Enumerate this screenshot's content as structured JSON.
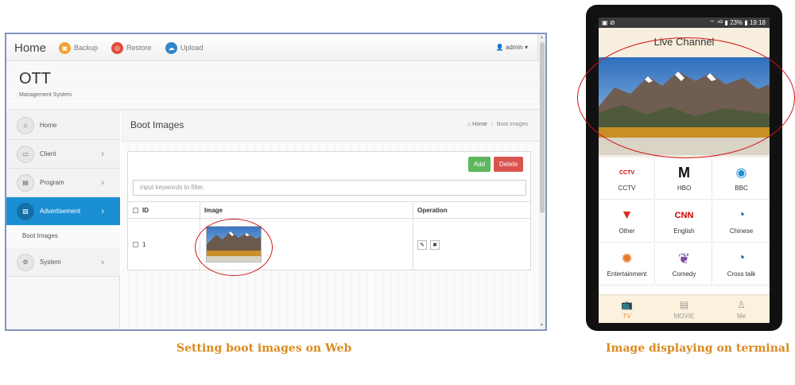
{
  "web": {
    "brand": "Home",
    "top_buttons": [
      {
        "label": "Backup",
        "icon": "backup-icon",
        "color": "#efa130",
        "glyph": "▣"
      },
      {
        "label": "Restore",
        "icon": "restore-icon",
        "color": "#e14b3b",
        "glyph": "◎"
      },
      {
        "label": "Upload",
        "icon": "cloud-upload-icon",
        "color": "#2f87c8",
        "glyph": "☁"
      }
    ],
    "user": {
      "name": "admin",
      "caret": "▾",
      "glyph": "👤"
    },
    "header": {
      "title": "OTT",
      "subtitle": "Management System"
    },
    "sidebar": {
      "items": [
        {
          "label": "Home",
          "glyph": "⌂"
        },
        {
          "label": "Client",
          "glyph": "▭",
          "chevron": "›"
        },
        {
          "label": "Program",
          "glyph": "▤",
          "chevron": "›"
        },
        {
          "label": "Advertisement",
          "glyph": "▨",
          "chevron": "›"
        },
        {
          "label": "System",
          "glyph": "⚙",
          "chevron": "›"
        }
      ],
      "sub_item": "Boot Images"
    },
    "page": {
      "title": "Boot Images",
      "breadcrumb": {
        "home_glyph": "⌂",
        "home": "Home",
        "sep": "/",
        "current": "Boot Images"
      }
    },
    "toolbar": {
      "add": "Add",
      "delete": "Delete"
    },
    "filter": {
      "placeholder": "input keywords to filter."
    },
    "table": {
      "headers": {
        "id": "ID",
        "image": "Image",
        "operation": "Operation"
      },
      "rows": [
        {
          "id": "1"
        }
      ],
      "ops": {
        "edit": "✎",
        "remove": "✖"
      }
    },
    "caption": "Setting boot images on Web"
  },
  "phone": {
    "status_left": "▣ ⊘",
    "status_right": "⌔ ⁴ᴳ ▮ 23% ▮ 19:18",
    "header_title": "Live Channel",
    "channels": [
      {
        "label": "CCTV",
        "logo": "CCTV"
      },
      {
        "label": "HBO",
        "logo": "M"
      },
      {
        "label": "BBC",
        "logo": "◉"
      },
      {
        "label": "Other",
        "logo": "▼"
      },
      {
        "label": "English",
        "logo": "CNN"
      },
      {
        "label": "Chinese",
        "logo": "◔"
      },
      {
        "label": "Entertainment",
        "logo": "✹"
      },
      {
        "label": "Comedy",
        "logo": "❦"
      },
      {
        "label": "Cross talk",
        "logo": "◔"
      }
    ],
    "tabs": [
      {
        "label": "TV",
        "glyph": "📺"
      },
      {
        "label": "MOVIE",
        "glyph": "▤"
      },
      {
        "label": "Me",
        "glyph": "♙"
      }
    ],
    "caption": "Image displaying on terminal"
  },
  "colors": {
    "accent_blue": "#1b8fd4",
    "add_green": "#5cb85c",
    "delete_red": "#d9534f",
    "caption_orange": "#d98a1e",
    "tab_active": "#e8902a",
    "annotation_red": "#d01616"
  }
}
